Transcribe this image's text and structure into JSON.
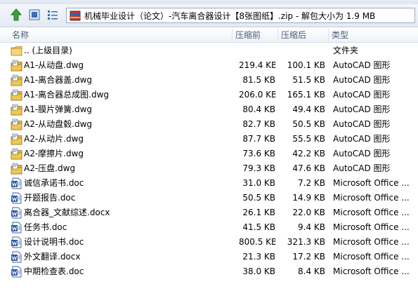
{
  "window": {
    "address_path": "机械毕业设计（论文）-汽车离合器设计【8张图纸】.zip - 解包大小为 1.9 MB"
  },
  "columns": {
    "name": "名称",
    "size": "压缩前",
    "compressed": "压缩后",
    "type": "类型"
  },
  "files": [
    {
      "name": ".. (上级目录)",
      "size": "",
      "compressed": "",
      "type": "文件夹",
      "icon": "folder-icon"
    },
    {
      "name": "A1-从动盘.dwg",
      "size": "219.4 KB",
      "compressed": "100.1 KB",
      "type": "AutoCAD 图形",
      "icon": "dwg-icon"
    },
    {
      "name": "A1-离合器盖.dwg",
      "size": "81.5 KB",
      "compressed": "51.5 KB",
      "type": "AutoCAD 图形",
      "icon": "dwg-icon"
    },
    {
      "name": "A1-离合器总成图.dwg",
      "size": "206.0 KB",
      "compressed": "165.1 KB",
      "type": "AutoCAD 图形",
      "icon": "dwg-icon"
    },
    {
      "name": "A1-膜片弹簧.dwg",
      "size": "80.4 KB",
      "compressed": "49.4 KB",
      "type": "AutoCAD 图形",
      "icon": "dwg-icon"
    },
    {
      "name": "A2-从动盘毂.dwg",
      "size": "82.7 KB",
      "compressed": "50.5 KB",
      "type": "AutoCAD 图形",
      "icon": "dwg-icon"
    },
    {
      "name": "A2-从动片.dwg",
      "size": "87.7 KB",
      "compressed": "55.5 KB",
      "type": "AutoCAD 图形",
      "icon": "dwg-icon"
    },
    {
      "name": "A2-摩擦片.dwg",
      "size": "73.6 KB",
      "compressed": "42.2 KB",
      "type": "AutoCAD 图形",
      "icon": "dwg-icon"
    },
    {
      "name": "A2-压盘.dwg",
      "size": "79.3 KB",
      "compressed": "47.6 KB",
      "type": "AutoCAD 图形",
      "icon": "dwg-icon"
    },
    {
      "name": "诚信承诺书.doc",
      "size": "31.0 KB",
      "compressed": "7.2 KB",
      "type": "Microsoft Office ...",
      "icon": "word-doc-icon"
    },
    {
      "name": "开题报告.doc",
      "size": "50.5 KB",
      "compressed": "14.9 KB",
      "type": "Microsoft Office ...",
      "icon": "word-doc-icon"
    },
    {
      "name": "离合器_文献综述.docx",
      "size": "26.1 KB",
      "compressed": "22.0 KB",
      "type": "Microsoft Office ...",
      "icon": "word-doc-icon"
    },
    {
      "name": "任务书.doc",
      "size": "41.5 KB",
      "compressed": "9.4 KB",
      "type": "Microsoft Office ...",
      "icon": "word-doc-icon"
    },
    {
      "name": "设计说明书.doc",
      "size": "800.5 KB",
      "compressed": "321.3 KB",
      "type": "Microsoft Office ...",
      "icon": "word-doc-icon"
    },
    {
      "name": "外文翻译.docx",
      "size": "21.3 KB",
      "compressed": "17.2 KB",
      "type": "Microsoft Office ...",
      "icon": "word-doc-icon"
    },
    {
      "name": "中期检查表.doc",
      "size": "38.0 KB",
      "compressed": "8.4 KB",
      "type": "Microsoft Office ...",
      "icon": "word-doc-icon"
    }
  ]
}
